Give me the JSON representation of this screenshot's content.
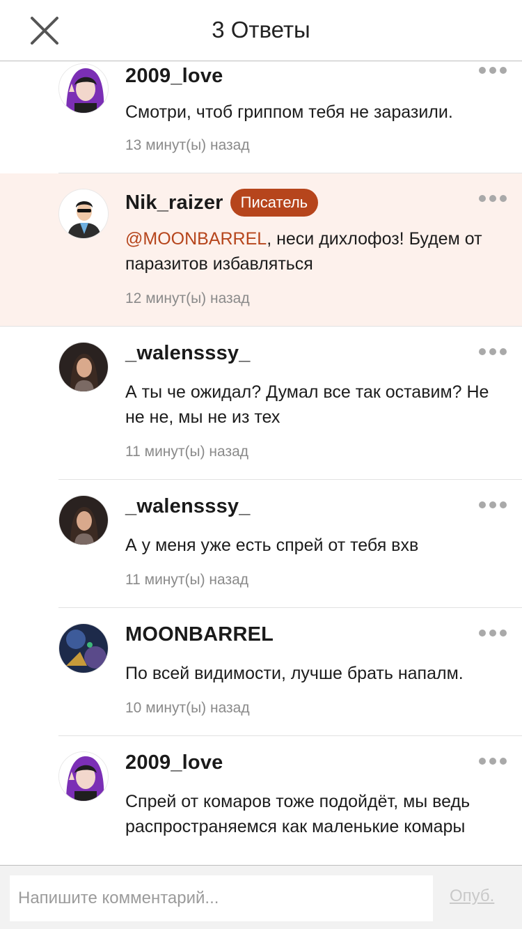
{
  "header": {
    "title": "3 Ответы"
  },
  "comments": [
    {
      "username": "2009_love",
      "text": "Смотри, чтоб гриппом тебя не заразили.",
      "time": "13 минут(ы) назад"
    },
    {
      "username": "Nik_raizer",
      "badge": "Писатель",
      "mention": "@MOONBARREL",
      "text": ", неси дихлофоз! Будем от паразитов избавляться",
      "time": "12 минут(ы) назад",
      "highlighted": true
    },
    {
      "username": "_walensssy_",
      "text": "А ты че ожидал? Думал все так оставим? Не не не, мы не из тех",
      "time": "11 минут(ы) назад"
    },
    {
      "username": "_walensssy_",
      "text": "А у меня уже есть спрей от тебя вхв",
      "time": "11 минут(ы) назад"
    },
    {
      "username": "MOONBARREL",
      "text": "По всей видимости, лучше брать напалм.",
      "time": "10 минут(ы) назад"
    },
    {
      "username": "2009_love",
      "text": "Спрей от комаров тоже подойдёт, мы ведь распространяемся как маленькие комары"
    }
  ],
  "footer": {
    "placeholder": "Напишите комментарий...",
    "publish_label": "Опуб."
  },
  "colors": {
    "accent": "#b6451c",
    "highlight_bg": "#fdf1ec",
    "muted": "#8a8a8a"
  }
}
